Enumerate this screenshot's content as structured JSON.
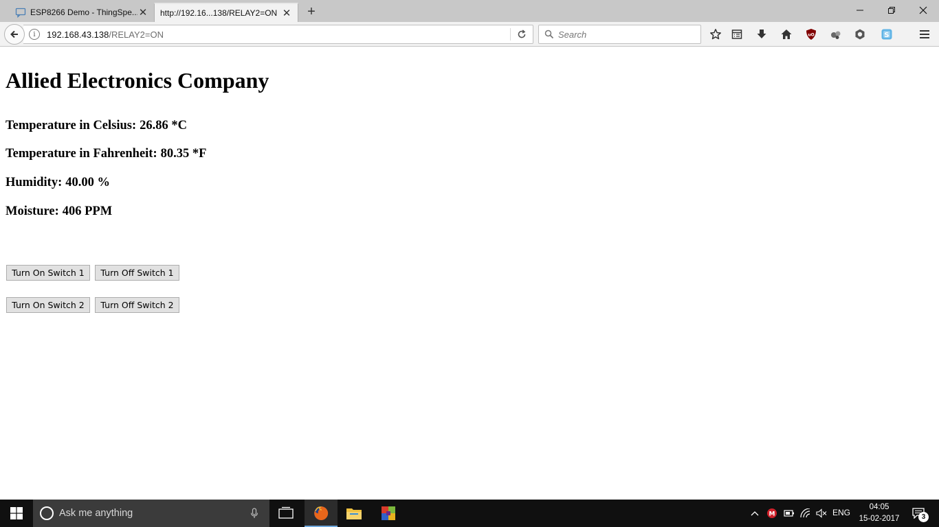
{
  "browser": {
    "tabs": [
      {
        "title": "ESP8266 Demo - ThingSpe...",
        "active": false
      },
      {
        "title": "http://192.16...138/RELAY2=ON",
        "active": true
      }
    ],
    "url": {
      "host": "192.168.43.138",
      "path": "/RELAY2=ON"
    },
    "search_placeholder": "Search",
    "toolbar_icons": [
      "bookmark-star-icon",
      "reading-list-icon",
      "downloads-icon",
      "home-icon",
      "ublock-icon",
      "extension-icon",
      "extension-icon",
      "skype-icon",
      "menu-icon"
    ]
  },
  "page": {
    "heading": "Allied Electronics Company",
    "readings": [
      {
        "label": "Temperature in Celsius:",
        "value": "26.86 *C"
      },
      {
        "label": "Temperature in Fahrenheit:",
        "value": "80.35 *F"
      },
      {
        "label": "Humidity:",
        "value": "40.00 %"
      },
      {
        "label": "Moisture:",
        "value": "406 PPM"
      }
    ],
    "buttons": {
      "on1": "Turn On Switch 1",
      "off1": "Turn Off Switch 1",
      "on2": "Turn On Switch 2",
      "off2": "Turn Off Switch 2"
    }
  },
  "taskbar": {
    "search_text": "Ask me anything",
    "language": "ENG",
    "time": "04:05",
    "date": "15-02-2017",
    "notification_count": "3"
  },
  "colors": {
    "tabstrip": "#c8c8c8",
    "navbar": "#f2f2f2",
    "taskbar": "#101010",
    "button_face": "#e1e1e1"
  }
}
